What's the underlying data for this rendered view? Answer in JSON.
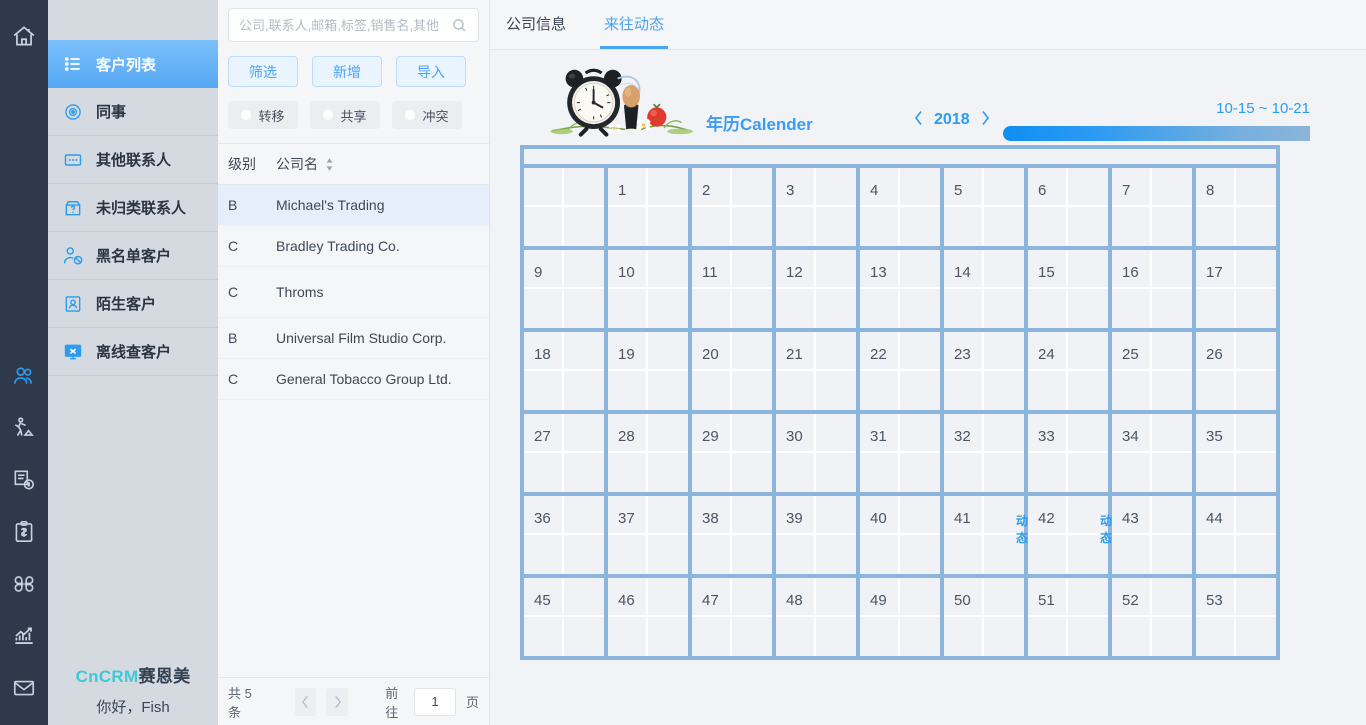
{
  "rail": {
    "icons": [
      {
        "name": "home-icon",
        "label": "首页"
      },
      {
        "name": "customers-icon",
        "label": "客户",
        "active": true
      },
      {
        "name": "business-trip-icon",
        "label": "外勤"
      },
      {
        "name": "invoice-icon",
        "label": "开票"
      },
      {
        "name": "finance-icon",
        "label": "财务"
      },
      {
        "name": "apps-icon",
        "label": "应用"
      },
      {
        "name": "chart-icon",
        "label": "统计"
      },
      {
        "name": "mail-icon",
        "label": "邮件"
      }
    ]
  },
  "sidebar": {
    "items": [
      {
        "label": "客户列表",
        "icon": "list-icon",
        "active": true
      },
      {
        "label": "同事",
        "icon": "circle-target-icon",
        "active": false
      },
      {
        "label": "其他联系人",
        "icon": "dots-card-icon",
        "active": false
      },
      {
        "label": "未归类联系人",
        "icon": "question-box-icon",
        "active": false
      },
      {
        "label": "黑名单客户",
        "icon": "user-block-icon",
        "active": false
      },
      {
        "label": "陌生客户",
        "icon": "user-card-icon",
        "active": false
      },
      {
        "label": "离线查客户",
        "icon": "offline-x-icon",
        "active": false
      }
    ],
    "brand_en": "CnCRM",
    "brand_cn": "赛恩美",
    "greeting": "你好，Fish"
  },
  "list_panel": {
    "search": {
      "placeholder": "公司,联系人,邮箱,标签,销售名,其他",
      "value": "",
      "icon": "search-icon"
    },
    "buttons": [
      {
        "label": "筛选",
        "name": "filter-button"
      },
      {
        "label": "新增",
        "name": "add-button"
      },
      {
        "label": "导入",
        "name": "import-button"
      }
    ],
    "chips": [
      {
        "label": "转移",
        "name": "transfer-chip"
      },
      {
        "label": "共享",
        "name": "share-chip"
      },
      {
        "label": "冲突",
        "name": "conflict-chip"
      }
    ],
    "table": {
      "headers": {
        "level": "级别",
        "company": "公司名"
      },
      "sort_icon": "sort-arrows-icon",
      "rows": [
        {
          "level": "B",
          "company": "Michael's Trading",
          "selected": true
        },
        {
          "level": "C",
          "company": "Bradley Trading Co.",
          "selected": false
        },
        {
          "level": "C",
          "company": "Throms",
          "selected": false
        },
        {
          "level": "B",
          "company": "Universal Film Studio Corp.",
          "selected": false
        },
        {
          "level": "C",
          "company": "General Tobacco Group Ltd.",
          "selected": false
        }
      ]
    },
    "pager": {
      "total_text": "共 5 条",
      "prev_icon": "chevron-left-icon",
      "next_icon": "chevron-right-icon",
      "goto_label": "前往",
      "page_value": "1",
      "page_unit": "页"
    }
  },
  "main": {
    "tabs": [
      {
        "label": "公司信息",
        "active": false
      },
      {
        "label": "来往动态",
        "active": true
      }
    ],
    "calendar": {
      "image_name": "alarm-clock-egg-photo",
      "title": "年历Calender",
      "prev_icon": "chevron-left-icon",
      "next_icon": "chevron-right-icon",
      "year": "2018",
      "range_label": "10-15 ~ 10-21",
      "accent_color": "#2b9cf0",
      "grid_border_color": "#8cb4dd",
      "cell_bg_color": "#f0f2f5",
      "dynamic_label": "动态",
      "rows": [
        [
          {
            "num": "",
            "dyn": false
          },
          {
            "num": "1",
            "dyn": false
          },
          {
            "num": "2",
            "dyn": false
          },
          {
            "num": "3",
            "dyn": false
          },
          {
            "num": "4",
            "dyn": false
          },
          {
            "num": "5",
            "dyn": false
          },
          {
            "num": "6",
            "dyn": false
          },
          {
            "num": "7",
            "dyn": false
          },
          {
            "num": "8",
            "dyn": false
          }
        ],
        [
          {
            "num": "9",
            "dyn": false
          },
          {
            "num": "10",
            "dyn": false
          },
          {
            "num": "11",
            "dyn": false
          },
          {
            "num": "12",
            "dyn": false
          },
          {
            "num": "13",
            "dyn": false
          },
          {
            "num": "14",
            "dyn": false
          },
          {
            "num": "15",
            "dyn": false
          },
          {
            "num": "16",
            "dyn": false
          },
          {
            "num": "17",
            "dyn": false
          }
        ],
        [
          {
            "num": "18",
            "dyn": false
          },
          {
            "num": "19",
            "dyn": false
          },
          {
            "num": "20",
            "dyn": false
          },
          {
            "num": "21",
            "dyn": false
          },
          {
            "num": "22",
            "dyn": false
          },
          {
            "num": "23",
            "dyn": false
          },
          {
            "num": "24",
            "dyn": false
          },
          {
            "num": "25",
            "dyn": false
          },
          {
            "num": "26",
            "dyn": false
          }
        ],
        [
          {
            "num": "27",
            "dyn": false
          },
          {
            "num": "28",
            "dyn": false
          },
          {
            "num": "29",
            "dyn": false
          },
          {
            "num": "30",
            "dyn": false
          },
          {
            "num": "31",
            "dyn": false
          },
          {
            "num": "32",
            "dyn": false
          },
          {
            "num": "33",
            "dyn": false
          },
          {
            "num": "34",
            "dyn": false
          },
          {
            "num": "35",
            "dyn": false
          }
        ],
        [
          {
            "num": "36",
            "dyn": false
          },
          {
            "num": "37",
            "dyn": false
          },
          {
            "num": "38",
            "dyn": false
          },
          {
            "num": "39",
            "dyn": false
          },
          {
            "num": "40",
            "dyn": false
          },
          {
            "num": "41",
            "dyn": true
          },
          {
            "num": "42",
            "dyn": true
          },
          {
            "num": "43",
            "dyn": false
          },
          {
            "num": "44",
            "dyn": false
          }
        ],
        [
          {
            "num": "45",
            "dyn": false
          },
          {
            "num": "46",
            "dyn": false
          },
          {
            "num": "47",
            "dyn": false
          },
          {
            "num": "48",
            "dyn": false
          },
          {
            "num": "49",
            "dyn": false
          },
          {
            "num": "50",
            "dyn": false
          },
          {
            "num": "51",
            "dyn": false
          },
          {
            "num": "52",
            "dyn": false
          },
          {
            "num": "53",
            "dyn": false
          }
        ]
      ]
    }
  }
}
